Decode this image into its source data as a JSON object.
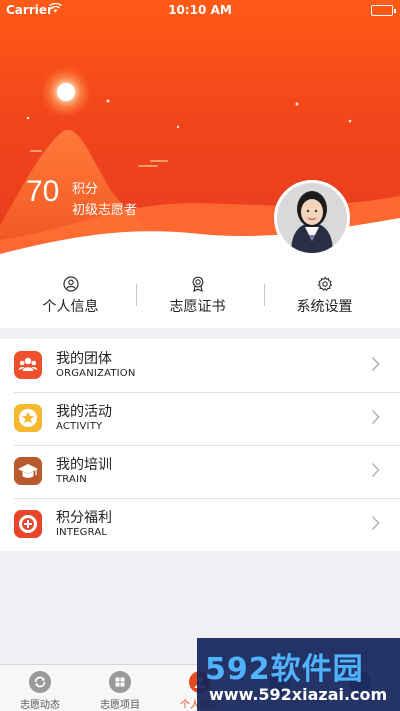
{
  "status_bar": {
    "carrier": "Carrier",
    "time": "10:10 AM"
  },
  "profile": {
    "points": "70",
    "points_unit": "积分",
    "level": "初级志愿者"
  },
  "quick_actions": [
    {
      "label": "个人信息",
      "icon": "person-icon"
    },
    {
      "label": "志愿证书",
      "icon": "certificate-icon"
    },
    {
      "label": "系统设置",
      "icon": "gear-icon"
    }
  ],
  "menu": [
    {
      "title": "我的团体",
      "subtitle": "ORGANIZATION",
      "icon": "group-icon",
      "color": "#f04f2e"
    },
    {
      "title": "我的活动",
      "subtitle": "ACTIVITY",
      "icon": "star-icon",
      "color": "#f5b82e"
    },
    {
      "title": "我的培训",
      "subtitle": "TRAIN",
      "icon": "graduation-cap-icon",
      "color": "#b85a2e"
    },
    {
      "title": "积分福利",
      "subtitle": "INTEGRAL",
      "icon": "points-icon",
      "color": "#e8452c"
    }
  ],
  "tabs": [
    {
      "label": "志愿动态",
      "icon": "refresh-icon"
    },
    {
      "label": "志愿项目",
      "icon": "grid-icon"
    },
    {
      "label": "个人中心",
      "icon": "user-icon",
      "active": true
    },
    {
      "label": "",
      "icon": ""
    },
    {
      "label": "",
      "icon": ""
    }
  ],
  "watermark": {
    "brand": "592软件园",
    "url": "www.592xiazai.com"
  },
  "colors": {
    "accent": "#e64a21",
    "header": "#f2451b"
  }
}
